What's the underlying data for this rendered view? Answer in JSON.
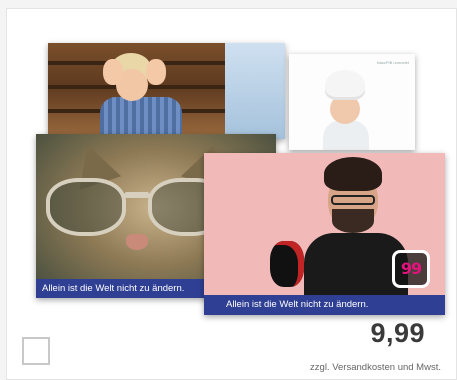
{
  "product": {
    "price": "9,99",
    "price_note": "zzgl. Versandkosten und Mwst."
  },
  "images": {
    "child_photo": {
      "description_icon": "child-photo-icon"
    },
    "baby_photo": {
      "tiny_text": "NaszPIB unmodet"
    },
    "cat_card": {
      "badge": "99",
      "caption": "Allein ist die Welt nicht zu ändern."
    },
    "man_card": {
      "badge": "99",
      "caption": "Allein ist die Welt nicht zu ändern."
    }
  },
  "colors": {
    "caption_bar": "#2f3f93",
    "badge_text": "#e3137d",
    "price_text": "#3a3a3a"
  }
}
